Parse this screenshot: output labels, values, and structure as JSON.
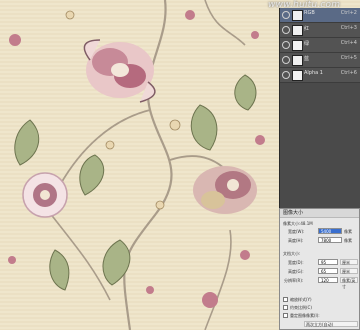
{
  "watermark": "www.huitu.com",
  "channels": {
    "rows": [
      {
        "label": "RGB",
        "shortcut": "Ctrl+2"
      },
      {
        "label": "红",
        "shortcut": "Ctrl+3"
      },
      {
        "label": "绿",
        "shortcut": "Ctrl+4"
      },
      {
        "label": "蓝",
        "shortcut": "Ctrl+5"
      },
      {
        "label": "Alpha 1",
        "shortcut": "Ctrl+6"
      }
    ]
  },
  "image_size_dialog": {
    "title": "图像大小",
    "pixel_size_label": "像素大小:48.1M",
    "width_label": "宽度(W):",
    "width_value": "5400",
    "width_unit": "像素",
    "height_label": "高度(H):",
    "height_value": "7800",
    "height_unit": "像素",
    "doc_size_label": "文档大小:",
    "doc_width_label": "宽度(D):",
    "doc_width_value": "95",
    "doc_width_unit": "厘米",
    "doc_height_label": "高度(G):",
    "doc_height_value": "65",
    "doc_height_unit": "厘米",
    "resolution_label": "分辨率(R):",
    "resolution_value": "120",
    "resolution_unit": "像素/英寸",
    "scale_styles_label": "缩放样式(Y)",
    "constrain_label": "约束比例(C)",
    "resample_label": "重定图像像素(I):",
    "resample_method": "两次立方(自动)"
  },
  "colors": {
    "panel_bg": "#4a4a4a",
    "selected_row": "#5a6a86",
    "dialog_bg": "#e7e7e7",
    "field_highlight": "#3a6fcf"
  }
}
